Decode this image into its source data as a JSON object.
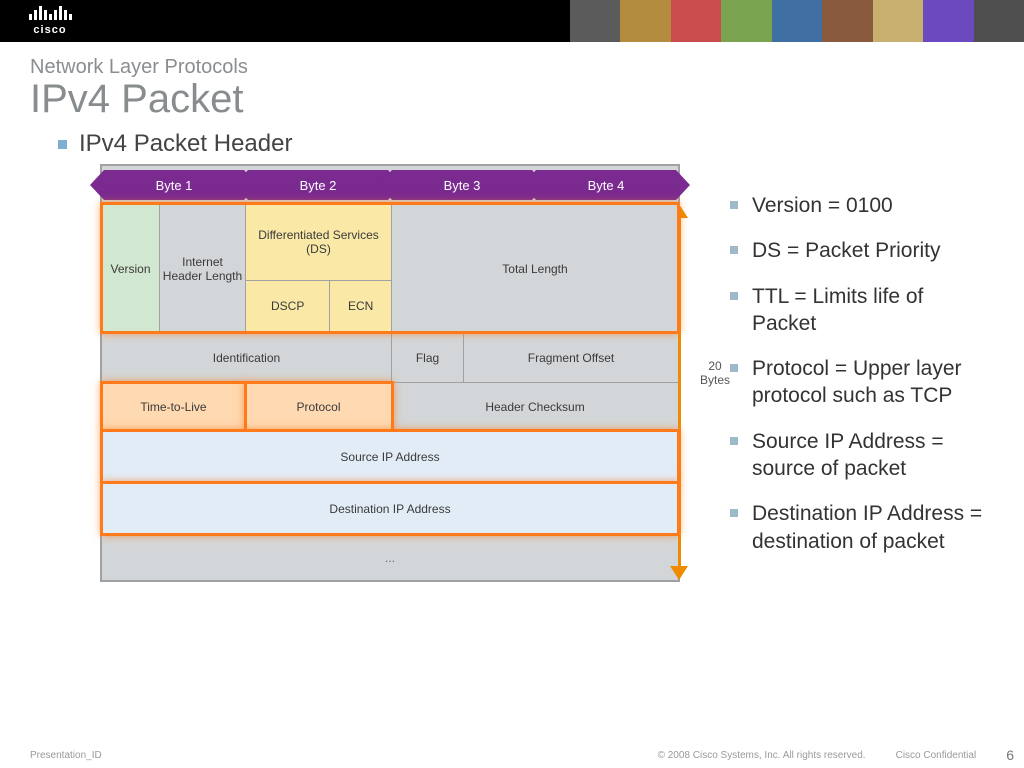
{
  "brand": "cisco",
  "pretitle": "Network Layer Protocols",
  "title": "IPv4 Packet",
  "subtitle": "IPv4 Packet Header",
  "bytes": [
    "Byte 1",
    "Byte 2",
    "Byte 3",
    "Byte 4"
  ],
  "rows": {
    "r1": {
      "version": "Version",
      "ihl": "Internet Header Length",
      "ds": "Differentiated Services (DS)",
      "dscp": "DSCP",
      "ecn": "ECN",
      "total_len": "Total Length"
    },
    "r2": {
      "ident": "Identification",
      "flag": "Flag",
      "frag": "Fragment Offset"
    },
    "r3": {
      "ttl": "Time-to-Live",
      "proto": "Protocol",
      "checksum": "Header Checksum"
    },
    "r4": {
      "src": "Source IP Address"
    },
    "r5": {
      "dst": "Destination IP Address"
    },
    "r6": {
      "opt": "..."
    }
  },
  "size_label": "20 Bytes",
  "notes": [
    "Version = 0100",
    "DS = Packet Priority",
    "TTL = Limits life of Packet",
    "Protocol = Upper layer protocol such as TCP",
    "Source IP Address = source of packet",
    "Destination IP Address = destination of packet"
  ],
  "footer": {
    "left": "Presentation_ID",
    "center": "© 2008 Cisco Systems, Inc. All rights reserved.",
    "conf": "Cisco Confidential",
    "page": "6"
  },
  "colors": {
    "accent_purple": "#7b2a90",
    "accent_orange": "#ff7a1a",
    "highlight_green": "#d2e7cf",
    "highlight_yellow": "#f9e8a6",
    "highlight_orange": "#ffd9b1",
    "highlight_blue": "#e2ecf7"
  }
}
